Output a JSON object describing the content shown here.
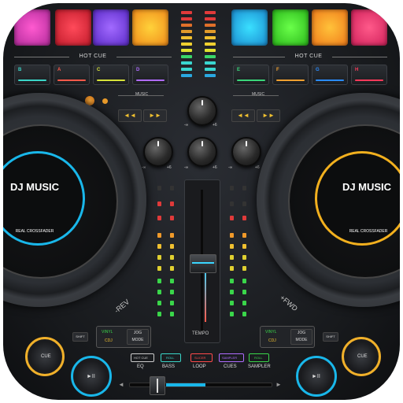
{
  "left_deck": {
    "hot_cue_title": "HOT CUE",
    "hot_cues": [
      {
        "label": "B",
        "color": "#3ad6c8"
      },
      {
        "label": "A",
        "color": "#ff5a4a"
      },
      {
        "label": "C",
        "color": "#d7e23a"
      },
      {
        "label": "D",
        "color": "#b06cff"
      }
    ],
    "music_label": "MUSIC",
    "rev_label": "-REV",
    "shift_label": "SHIFT",
    "vinyl_label": "VINYL",
    "cdj_label": "CDJ",
    "jog_mode_label": "JOG MODE",
    "disc_title": "DJ MUSIC",
    "disc_subtitle": "REAL CROSSFADER",
    "disc_ring_color": "#19b7ea",
    "cue_label": "CUE",
    "play_label": "►II"
  },
  "right_deck": {
    "hot_cue_title": "HOT CUE",
    "hot_cues": [
      {
        "label": "E",
        "color": "#3ad67a"
      },
      {
        "label": "F",
        "color": "#f0a030"
      },
      {
        "label": "G",
        "color": "#2a8cff"
      },
      {
        "label": "H",
        "color": "#ff3a5a"
      }
    ],
    "music_label": "MUSIC",
    "fwd_label": "+FWD",
    "shift_label": "SHIFT",
    "vinyl_label": "VINYL",
    "cdj_label": "CDJ",
    "jog_mode_label": "JOG MODE",
    "disc_title": "DJ MUSIC",
    "disc_subtitle": "REAL CROSSFADER",
    "disc_ring_color": "#f2b01e",
    "cue_label": "CUE",
    "play_label": "►II"
  },
  "mixer": {
    "knob_min": "-∞",
    "knob_max": "+6",
    "tempo_label": "TEMPO"
  },
  "bottom_bar": {
    "items": [
      {
        "tag": "HOT CUE",
        "label": "EQ",
        "color": "#cccccc"
      },
      {
        "tag": "ROLL",
        "label": "BASS",
        "color": "#3ad6c8"
      },
      {
        "tag": "SLICER",
        "label": "LOOP",
        "color": "#ff4a4a"
      },
      {
        "tag": "SAMPLER",
        "label": "CUES",
        "color": "#b06cff"
      },
      {
        "tag": "ROLL",
        "label": "SAMPLER",
        "color": "#3ad64a"
      }
    ],
    "crossfader_left": "◄",
    "crossfader_right": "►"
  }
}
